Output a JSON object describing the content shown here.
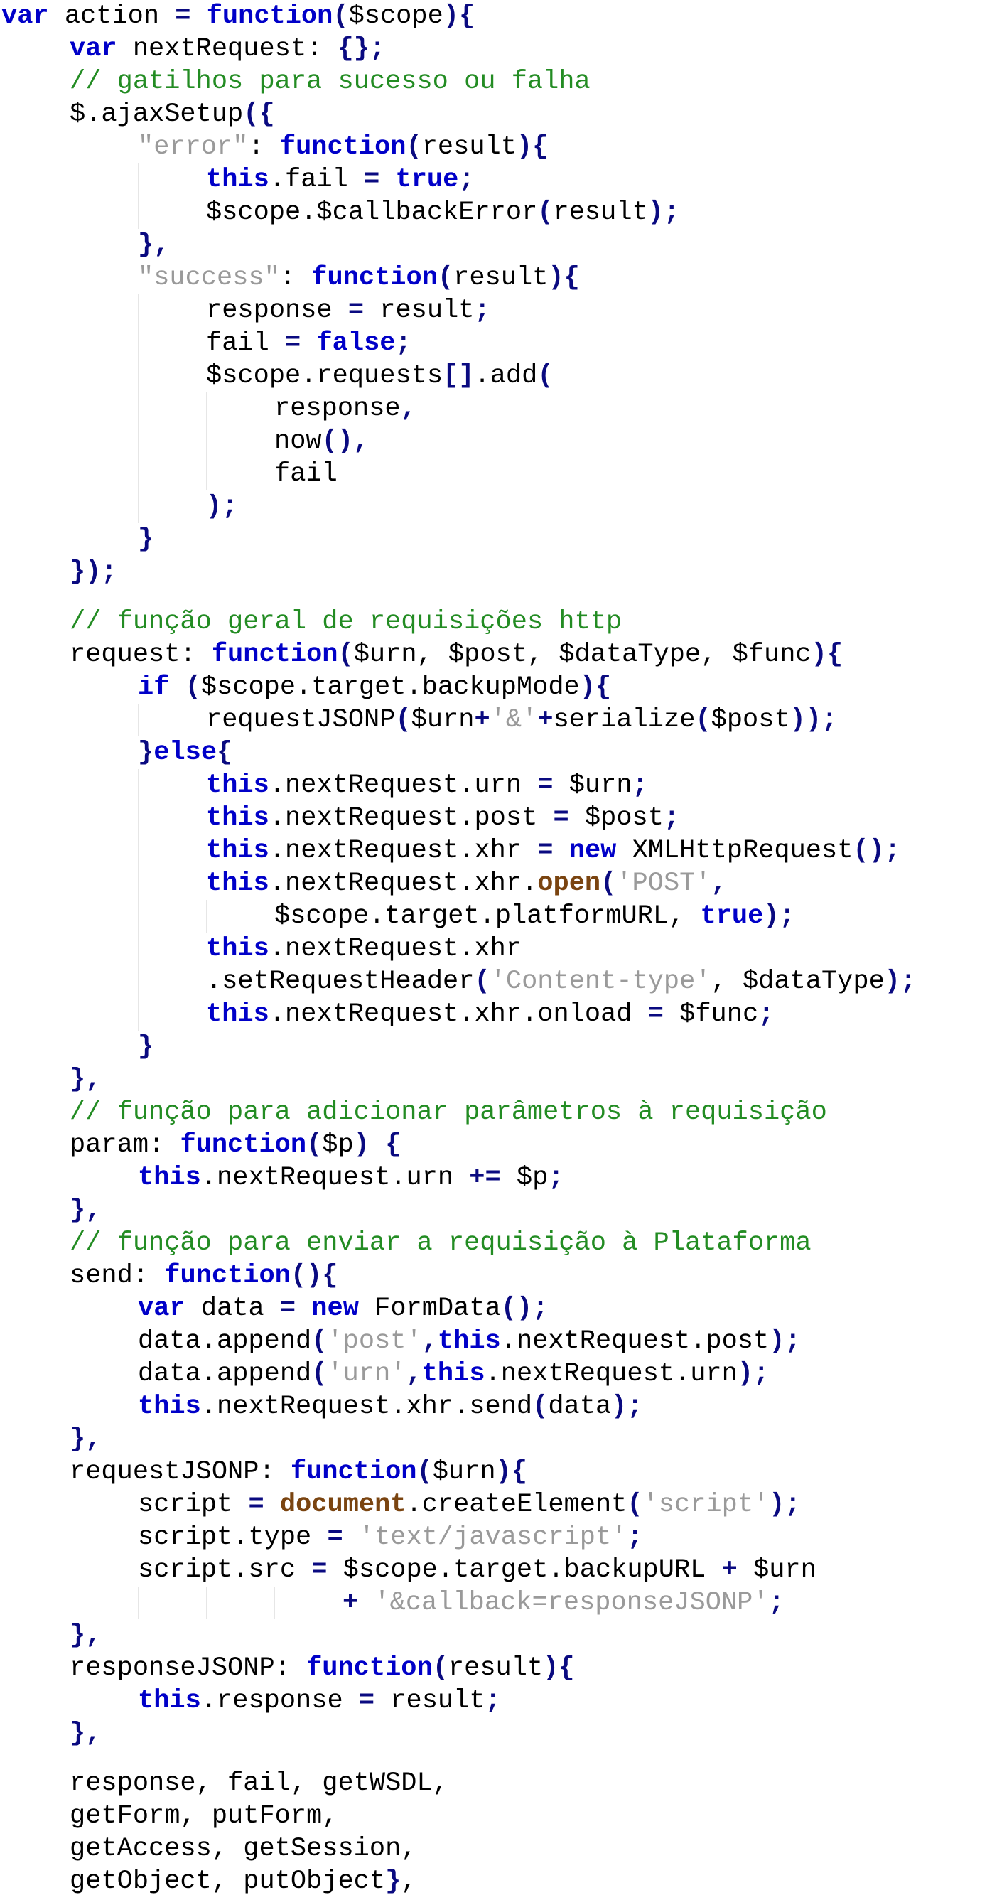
{
  "document": {
    "language": "javascript",
    "colors": {
      "background": "#ffffff",
      "keyword": "#0000c8",
      "punctuation": "#0a0a80",
      "comment": "#238c23",
      "string": "#9a9a9a",
      "builtin": "#7a4410",
      "identifier": "#000000"
    },
    "lines": [
      {
        "i": 0,
        "t": [
          [
            "kw",
            "var"
          ],
          [
            "id",
            " action "
          ],
          [
            "p",
            "="
          ],
          [
            "id",
            " "
          ],
          [
            "kw",
            "function"
          ],
          [
            "p",
            "("
          ],
          [
            "id",
            "$scope"
          ],
          [
            "p",
            ")"
          ],
          [
            "p",
            "{"
          ]
        ]
      },
      {
        "i": 1,
        "t": [
          [
            "kw",
            "var"
          ],
          [
            "id",
            " nextRequest: "
          ],
          [
            "p",
            "{}"
          ],
          [
            "p",
            ";"
          ]
        ]
      },
      {
        "i": 1,
        "t": [
          [
            "cm",
            "// gatilhos para sucesso ou falha"
          ]
        ]
      },
      {
        "i": 1,
        "t": [
          [
            "id",
            "$.ajaxSetup"
          ],
          [
            "p",
            "({"
          ]
        ]
      },
      {
        "i": 2,
        "t": [
          [
            "str",
            "\"error\""
          ],
          [
            "id",
            ": "
          ],
          [
            "kw",
            "function"
          ],
          [
            "p",
            "("
          ],
          [
            "id",
            "result"
          ],
          [
            "p",
            ")"
          ],
          [
            "p",
            "{"
          ]
        ]
      },
      {
        "i": 3,
        "t": [
          [
            "kw",
            "this"
          ],
          [
            "id",
            ".fail "
          ],
          [
            "p",
            "="
          ],
          [
            "id",
            " "
          ],
          [
            "kw",
            "true"
          ],
          [
            "p",
            ";"
          ]
        ]
      },
      {
        "i": 3,
        "t": [
          [
            "id",
            "$scope.$callbackError"
          ],
          [
            "p",
            "("
          ],
          [
            "id",
            "result"
          ],
          [
            "p",
            ")"
          ],
          [
            "p",
            ";"
          ]
        ]
      },
      {
        "i": 2,
        "t": [
          [
            "p",
            "},"
          ]
        ]
      },
      {
        "i": 2,
        "t": [
          [
            "str",
            "\"success\""
          ],
          [
            "id",
            ": "
          ],
          [
            "kw",
            "function"
          ],
          [
            "p",
            "("
          ],
          [
            "id",
            "result"
          ],
          [
            "p",
            ")"
          ],
          [
            "p",
            "{"
          ]
        ]
      },
      {
        "i": 3,
        "t": [
          [
            "id",
            "response "
          ],
          [
            "p",
            "="
          ],
          [
            "id",
            " result"
          ],
          [
            "p",
            ";"
          ]
        ]
      },
      {
        "i": 3,
        "t": [
          [
            "id",
            "fail "
          ],
          [
            "p",
            "="
          ],
          [
            "id",
            " "
          ],
          [
            "kw",
            "false"
          ],
          [
            "p",
            ";"
          ]
        ]
      },
      {
        "i": 3,
        "t": [
          [
            "id",
            "$scope.requests"
          ],
          [
            "p",
            "[]"
          ],
          [
            "id",
            ".add"
          ],
          [
            "p",
            "("
          ]
        ]
      },
      {
        "i": 4,
        "t": [
          [
            "id",
            "response"
          ],
          [
            "p",
            ","
          ]
        ]
      },
      {
        "i": 4,
        "t": [
          [
            "id",
            "now"
          ],
          [
            "p",
            "()"
          ],
          [
            "p",
            ","
          ]
        ]
      },
      {
        "i": 4,
        "t": [
          [
            "id",
            "fail"
          ]
        ]
      },
      {
        "i": 3,
        "t": [
          [
            "p",
            ")"
          ],
          [
            "p",
            ";"
          ]
        ]
      },
      {
        "i": 2,
        "t": [
          [
            "p",
            "}"
          ]
        ]
      },
      {
        "i": 1,
        "t": [
          [
            "p",
            "})"
          ],
          [
            "p",
            ";"
          ]
        ]
      },
      {
        "gap": true
      },
      {
        "i": 1,
        "t": [
          [
            "cm",
            "// função geral de requisições http"
          ]
        ]
      },
      {
        "i": 1,
        "t": [
          [
            "id",
            "request: "
          ],
          [
            "kw",
            "function"
          ],
          [
            "p",
            "("
          ],
          [
            "id",
            "$urn, $post, $dataType, $func"
          ],
          [
            "p",
            ")"
          ],
          [
            "p",
            "{"
          ]
        ]
      },
      {
        "i": 2,
        "t": [
          [
            "kw",
            "if"
          ],
          [
            "id",
            " "
          ],
          [
            "p",
            "("
          ],
          [
            "id",
            "$scope.target.backupMode"
          ],
          [
            "p",
            ")"
          ],
          [
            "p",
            "{"
          ]
        ]
      },
      {
        "i": 3,
        "t": [
          [
            "id",
            "requestJSONP"
          ],
          [
            "p",
            "("
          ],
          [
            "id",
            "$urn"
          ],
          [
            "p",
            "+"
          ],
          [
            "str",
            "'&'"
          ],
          [
            "p",
            "+"
          ],
          [
            "id",
            "serialize"
          ],
          [
            "p",
            "("
          ],
          [
            "id",
            "$post"
          ],
          [
            "p",
            "))"
          ],
          [
            "p",
            ";"
          ]
        ]
      },
      {
        "i": 2,
        "t": [
          [
            "p",
            "}"
          ],
          [
            "kw",
            "else"
          ],
          [
            "p",
            "{"
          ]
        ]
      },
      {
        "i": 3,
        "t": [
          [
            "kw",
            "this"
          ],
          [
            "id",
            ".nextRequest.urn "
          ],
          [
            "p",
            "="
          ],
          [
            "id",
            " $urn"
          ],
          [
            "p",
            ";"
          ]
        ]
      },
      {
        "i": 3,
        "t": [
          [
            "kw",
            "this"
          ],
          [
            "id",
            ".nextRequest.post "
          ],
          [
            "p",
            "="
          ],
          [
            "id",
            " $post"
          ],
          [
            "p",
            ";"
          ]
        ]
      },
      {
        "i": 3,
        "t": [
          [
            "kw",
            "this"
          ],
          [
            "id",
            ".nextRequest.xhr "
          ],
          [
            "p",
            "="
          ],
          [
            "id",
            " "
          ],
          [
            "kw",
            "new"
          ],
          [
            "id",
            " XMLHttpRequest"
          ],
          [
            "p",
            "()"
          ],
          [
            "p",
            ";"
          ]
        ]
      },
      {
        "i": 3,
        "t": [
          [
            "kw",
            "this"
          ],
          [
            "id",
            ".nextRequest.xhr."
          ],
          [
            "bi",
            "open"
          ],
          [
            "p",
            "("
          ],
          [
            "str",
            "'POST'"
          ],
          [
            "p",
            ","
          ]
        ]
      },
      {
        "i": 4,
        "t": [
          [
            "id",
            "$scope.target.platformURL, "
          ],
          [
            "kw",
            "true"
          ],
          [
            "p",
            ")"
          ],
          [
            "p",
            ";"
          ]
        ]
      },
      {
        "i": 3,
        "t": [
          [
            "kw",
            "this"
          ],
          [
            "id",
            ".nextRequest.xhr"
          ]
        ]
      },
      {
        "i": 3,
        "t": [
          [
            "id",
            ".setRequestHeader"
          ],
          [
            "p",
            "("
          ],
          [
            "str",
            "'Content-type'"
          ],
          [
            "id",
            ", $dataType"
          ],
          [
            "p",
            ")"
          ],
          [
            "p",
            ";"
          ]
        ]
      },
      {
        "i": 3,
        "t": [
          [
            "kw",
            "this"
          ],
          [
            "id",
            ".nextRequest.xhr.onload "
          ],
          [
            "p",
            "="
          ],
          [
            "id",
            " $func"
          ],
          [
            "p",
            ";"
          ]
        ]
      },
      {
        "i": 2,
        "t": [
          [
            "p",
            "}"
          ]
        ]
      },
      {
        "i": 1,
        "t": [
          [
            "p",
            "},"
          ]
        ]
      },
      {
        "i": 1,
        "t": [
          [
            "cm",
            "// função para adicionar parâmetros à requisição"
          ]
        ]
      },
      {
        "i": 1,
        "t": [
          [
            "id",
            "param: "
          ],
          [
            "kw",
            "function"
          ],
          [
            "p",
            "("
          ],
          [
            "id",
            "$p"
          ],
          [
            "p",
            ")"
          ],
          [
            "id",
            " "
          ],
          [
            "p",
            "{"
          ]
        ]
      },
      {
        "i": 2,
        "t": [
          [
            "kw",
            "this"
          ],
          [
            "id",
            ".nextRequest.urn "
          ],
          [
            "p",
            "+="
          ],
          [
            "id",
            " $p"
          ],
          [
            "p",
            ";"
          ]
        ]
      },
      {
        "i": 1,
        "t": [
          [
            "p",
            "},"
          ]
        ]
      },
      {
        "i": 1,
        "t": [
          [
            "cm",
            "// função para enviar a requisição à Plataforma"
          ]
        ]
      },
      {
        "i": 1,
        "t": [
          [
            "id",
            "send: "
          ],
          [
            "kw",
            "function"
          ],
          [
            "p",
            "()"
          ],
          [
            "p",
            "{"
          ]
        ]
      },
      {
        "i": 2,
        "t": [
          [
            "kw",
            "var"
          ],
          [
            "id",
            " data "
          ],
          [
            "p",
            "="
          ],
          [
            "id",
            " "
          ],
          [
            "kw",
            "new"
          ],
          [
            "id",
            " FormData"
          ],
          [
            "p",
            "()"
          ],
          [
            "p",
            ";"
          ]
        ]
      },
      {
        "i": 2,
        "t": [
          [
            "id",
            "data.append"
          ],
          [
            "p",
            "("
          ],
          [
            "str",
            "'post'"
          ],
          [
            "p",
            ","
          ],
          [
            "kw",
            "this"
          ],
          [
            "id",
            ".nextRequest.post"
          ],
          [
            "p",
            ")"
          ],
          [
            "p",
            ";"
          ]
        ]
      },
      {
        "i": 2,
        "t": [
          [
            "id",
            "data.append"
          ],
          [
            "p",
            "("
          ],
          [
            "str",
            "'urn'"
          ],
          [
            "p",
            ","
          ],
          [
            "kw",
            "this"
          ],
          [
            "id",
            ".nextRequest.urn"
          ],
          [
            "p",
            ")"
          ],
          [
            "p",
            ";"
          ]
        ]
      },
      {
        "i": 2,
        "t": [
          [
            "kw",
            "this"
          ],
          [
            "id",
            ".nextRequest.xhr.send"
          ],
          [
            "p",
            "("
          ],
          [
            "id",
            "data"
          ],
          [
            "p",
            ")"
          ],
          [
            "p",
            ";"
          ]
        ]
      },
      {
        "i": 1,
        "t": [
          [
            "p",
            "},"
          ]
        ]
      },
      {
        "i": 1,
        "t": [
          [
            "id",
            "requestJSONP: "
          ],
          [
            "kw",
            "function"
          ],
          [
            "p",
            "("
          ],
          [
            "id",
            "$urn"
          ],
          [
            "p",
            ")"
          ],
          [
            "p",
            "{"
          ]
        ]
      },
      {
        "i": 2,
        "t": [
          [
            "id",
            "script "
          ],
          [
            "p",
            "="
          ],
          [
            "id",
            " "
          ],
          [
            "bi",
            "document"
          ],
          [
            "id",
            ".createElement"
          ],
          [
            "p",
            "("
          ],
          [
            "str",
            "'script'"
          ],
          [
            "p",
            ")"
          ],
          [
            "p",
            ";"
          ]
        ]
      },
      {
        "i": 2,
        "t": [
          [
            "id",
            "script.type "
          ],
          [
            "p",
            "="
          ],
          [
            "id",
            " "
          ],
          [
            "str",
            "'text/javascript'"
          ],
          [
            "p",
            ";"
          ]
        ]
      },
      {
        "i": 2,
        "t": [
          [
            "id",
            "script.src "
          ],
          [
            "p",
            "="
          ],
          [
            "id",
            " $scope.target.backupURL "
          ],
          [
            "p",
            "+"
          ],
          [
            "id",
            " $urn"
          ]
        ]
      },
      {
        "i": 5,
        "t": [
          [
            "p",
            "+"
          ],
          [
            "id",
            " "
          ],
          [
            "str",
            "'&callback=responseJSONP'"
          ],
          [
            "p",
            ";"
          ]
        ]
      },
      {
        "i": 1,
        "t": [
          [
            "p",
            "},"
          ]
        ]
      },
      {
        "i": 1,
        "t": [
          [
            "id",
            "responseJSONP: "
          ],
          [
            "kw",
            "function"
          ],
          [
            "p",
            "("
          ],
          [
            "id",
            "result"
          ],
          [
            "p",
            ")"
          ],
          [
            "p",
            "{"
          ]
        ]
      },
      {
        "i": 2,
        "t": [
          [
            "kw",
            "this"
          ],
          [
            "id",
            ".response "
          ],
          [
            "p",
            "="
          ],
          [
            "id",
            " result"
          ],
          [
            "p",
            ";"
          ]
        ]
      },
      {
        "i": 1,
        "t": [
          [
            "p",
            "},"
          ]
        ]
      },
      {
        "gap": true
      },
      {
        "i": 1,
        "t": [
          [
            "id",
            "response, fail, getWSDL,"
          ]
        ]
      },
      {
        "i": 1,
        "t": [
          [
            "id",
            "getForm, putForm,"
          ]
        ]
      },
      {
        "i": 1,
        "t": [
          [
            "id",
            "getAccess, getSession,"
          ]
        ]
      },
      {
        "i": 1,
        "t": [
          [
            "id",
            "getObject, putObject"
          ],
          [
            "p",
            "}"
          ],
          [
            "id",
            ","
          ]
        ]
      }
    ]
  }
}
